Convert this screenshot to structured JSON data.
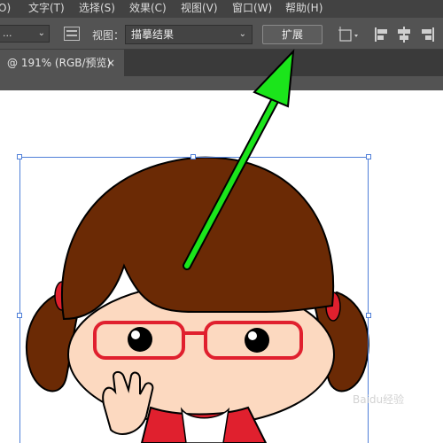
{
  "menu": {
    "items": [
      "O)",
      "文字(T)",
      "选择(S)",
      "效果(C)",
      "视图(V)",
      "窗口(W)",
      "帮助(H)"
    ]
  },
  "controlbar": {
    "preset_value": "...",
    "view_label": "视图：",
    "view_value": "描摹结果",
    "expand_label": "扩展"
  },
  "tab": {
    "title": "@ 191% (RGB/预览)",
    "close": "×"
  },
  "watermark": "Baidu经验",
  "colors": {
    "accent_arrow": "#1be51b",
    "selection": "#4f7fd8",
    "hair": "#6b2a05"
  }
}
